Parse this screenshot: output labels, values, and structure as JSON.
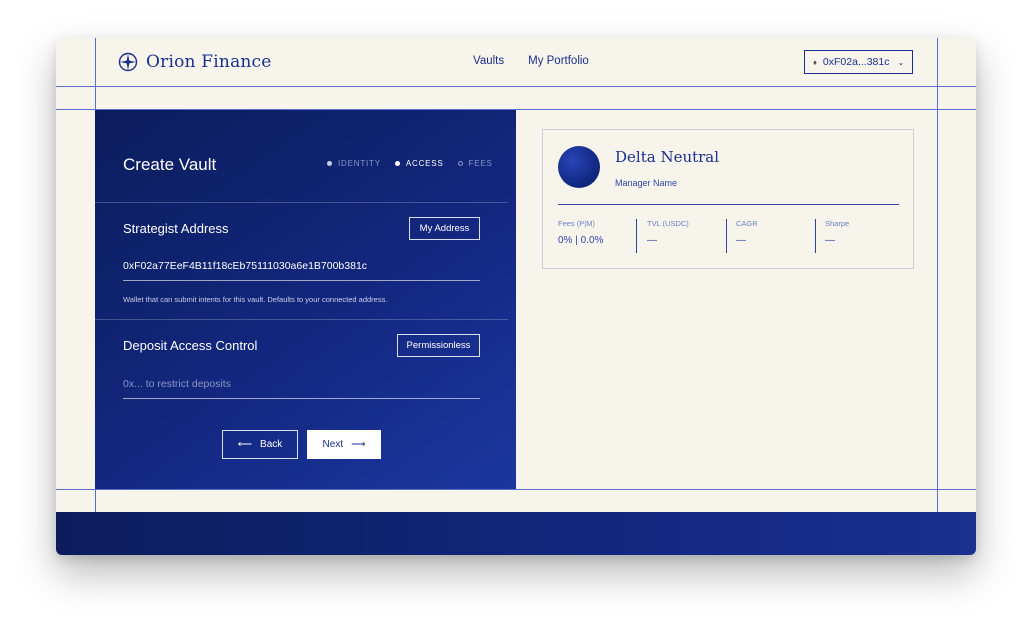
{
  "brand": {
    "name": "Orion Finance"
  },
  "nav": {
    "vaults": "Vaults",
    "portfolio": "My Portfolio"
  },
  "wallet": {
    "address": "0xF02a...381c",
    "icon": "ethereum-icon"
  },
  "form": {
    "title": "Create Vault",
    "steps": [
      {
        "label": "IDENTITY",
        "state": "done"
      },
      {
        "label": "ACCESS",
        "state": "active"
      },
      {
        "label": "FEES",
        "state": "todo"
      }
    ],
    "strategist": {
      "label": "Strategist Address",
      "button": "My Address",
      "value": "0xF02a77EeF4B11f18cEb75111030a6e1B700b381c",
      "hint": "Wallet that can submit intents for this vault. Defaults to your connected address."
    },
    "deposit": {
      "label": "Deposit Access Control",
      "button": "Permissionless",
      "placeholder": "0x... to restrict deposits"
    },
    "back_label": "Back",
    "next_label": "Next"
  },
  "preview": {
    "name": "Delta Neutral",
    "manager": "Manager Name",
    "stats": [
      {
        "label": "Fees (P|M)",
        "value": "0% | 0.0%"
      },
      {
        "label": "TVL (USDC)",
        "value": "—"
      },
      {
        "label": "CAGR",
        "value": "—"
      },
      {
        "label": "Sharpe",
        "value": "—"
      }
    ]
  },
  "colors": {
    "accent": "#1a2f8f",
    "panel": "#13277f",
    "background": "#f7f4ec"
  }
}
